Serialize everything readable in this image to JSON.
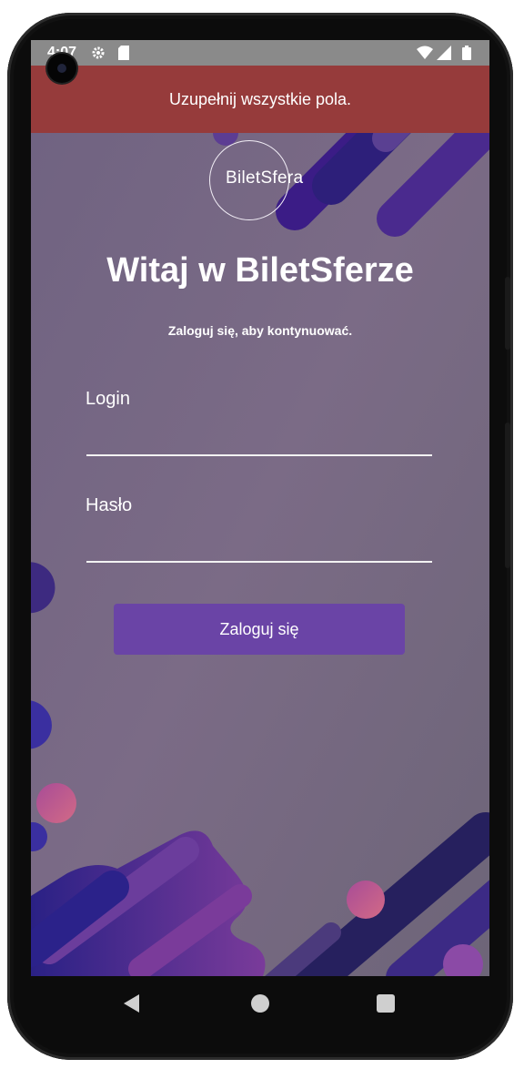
{
  "status_bar": {
    "time": "4:07"
  },
  "snackbar": {
    "message": "Uzupełnij wszystkie pola."
  },
  "logo": {
    "text": "BiletSfera"
  },
  "header": {
    "title": "Witaj w BiletSferze",
    "subtitle": "Zaloguj się, aby kontynuować."
  },
  "form": {
    "login_label": "Login",
    "login_value": "",
    "password_label": "Hasło",
    "password_value": "",
    "submit_label": "Zaloguj się"
  },
  "colors": {
    "snackbar_bg": "#963b3b",
    "button_bg": "#6a44a6",
    "background": "#7a6d87",
    "shape_dark": "#3b1c86",
    "shape_violet": "#7b3fa0",
    "shape_pink": "#b0568f"
  },
  "icons": {
    "settings": "gear-icon",
    "sd_card": "sd-card-icon",
    "wifi": "wifi-icon",
    "signal": "signal-icon",
    "battery": "battery-icon",
    "back": "back-triangle-icon",
    "home": "home-circle-icon",
    "recents": "recents-square-icon"
  }
}
